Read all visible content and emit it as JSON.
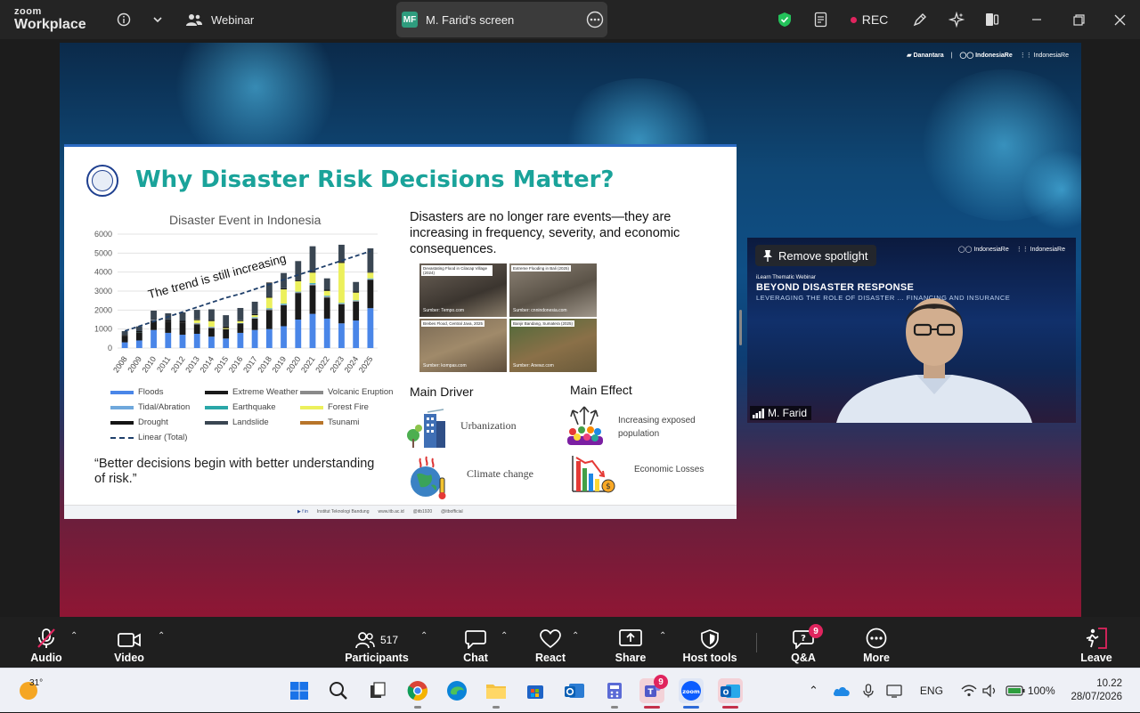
{
  "app": {
    "brand_line1": "zoom",
    "brand_line2": "Workplace",
    "meeting_type": "Webinar",
    "share_initials": "MF",
    "share_label": "M. Farid's screen",
    "rec_label": "REC"
  },
  "slide": {
    "title": "Why Disaster Risk Decisions Matter?",
    "intro": "Disasters are no longer rare events—they are increasing in frequency, severity, and economic consequences.",
    "quote": "“Better decisions begin with better understanding of risk.”",
    "photos": [
      {
        "caption": "Devastating Flood in Cilacap Village (2024)",
        "source": "Sumber: Tempo.com"
      },
      {
        "caption": "Extreme Flooding in Bali (2025)",
        "source": "Sumber: cnnindonesia.com"
      },
      {
        "caption": "Brebes Flood, Central Java, 2025",
        "source": "Sumber: kompas.com"
      },
      {
        "caption": "Banjir Bandang, Sumatera (2025)",
        "source": "Sumber: Anewz.com"
      }
    ],
    "main_driver": {
      "heading": "Main Driver",
      "items": [
        "Urbanization",
        "Climate change"
      ]
    },
    "main_effect": {
      "heading": "Main Effect",
      "items": [
        "Increasing exposed population",
        "Economic Losses"
      ]
    },
    "footer": [
      "Institut Teknologi Bandung",
      "www.itb.ac.id",
      "@itb1920",
      "@itbofficial"
    ]
  },
  "chart_data": {
    "type": "bar",
    "stacked": true,
    "title": "Disaster Event in Indonesia",
    "annotation": "The trend is still increasing",
    "categories": [
      "2008",
      "2009",
      "2010",
      "2011",
      "2012",
      "2013",
      "2014",
      "2015",
      "2016",
      "2017",
      "2018",
      "2019",
      "2020",
      "2021",
      "2022",
      "2023",
      "2024",
      "2025"
    ],
    "ylim": [
      0,
      6000
    ],
    "yticks": [
      0,
      1000,
      2000,
      3000,
      4000,
      5000,
      6000
    ],
    "grid": true,
    "legend_position": "bottom",
    "series": [
      {
        "name": "Floods",
        "color": "#4a86e8",
        "values": [
          300,
          400,
          950,
          800,
          700,
          750,
          600,
          500,
          800,
          950,
          1000,
          1150,
          1500,
          1800,
          1550,
          1300,
          1450,
          2100
        ]
      },
      {
        "name": "Extreme Weather",
        "color": "#1a1a1a",
        "values": [
          350,
          400,
          500,
          600,
          650,
          500,
          450,
          500,
          500,
          600,
          1000,
          1100,
          1400,
          1500,
          1100,
          1000,
          1000,
          1500
        ]
      },
      {
        "name": "Volcanic Eruption",
        "color": "#8a8a8a",
        "values": [
          0,
          0,
          20,
          0,
          0,
          50,
          40,
          0,
          0,
          30,
          40,
          20,
          30,
          40,
          50,
          30,
          30,
          20
        ]
      },
      {
        "name": "Tidal/Abration",
        "color": "#6fa8dc",
        "values": [
          0,
          0,
          20,
          0,
          0,
          20,
          30,
          0,
          20,
          30,
          30,
          40,
          20,
          40,
          30,
          20,
          20,
          20
        ]
      },
      {
        "name": "Earthquake",
        "color": "#2aa7a8",
        "values": [
          0,
          10,
          0,
          0,
          0,
          0,
          0,
          0,
          0,
          20,
          30,
          30,
          20,
          40,
          30,
          30,
          20,
          30
        ]
      },
      {
        "name": "Forest Fire",
        "color": "#ecf05c",
        "values": [
          0,
          0,
          0,
          0,
          0,
          150,
          300,
          50,
          100,
          100,
          550,
          750,
          550,
          550,
          250,
          2100,
          400,
          300
        ]
      },
      {
        "name": "Drought",
        "color": "#141414",
        "values": [
          40,
          80,
          30,
          80,
          80,
          40,
          70,
          80,
          40,
          60,
          50,
          60,
          60,
          40,
          60,
          60,
          60,
          30
        ]
      },
      {
        "name": "Landslide",
        "color": "#3a4652",
        "values": [
          200,
          250,
          450,
          350,
          450,
          500,
          550,
          600,
          650,
          650,
          750,
          800,
          1000,
          1350,
          600,
          900,
          500,
          1250
        ]
      },
      {
        "name": "Tsunami",
        "color": "#b8752a",
        "values": [
          0,
          0,
          0,
          0,
          0,
          0,
          0,
          0,
          0,
          0,
          10,
          0,
          0,
          0,
          0,
          0,
          0,
          0
        ]
      },
      {
        "name": "Linear (Total)",
        "color": "#1f3f6a",
        "type": "trendline",
        "values": [
          900,
          1150,
          1400,
          1650,
          1900,
          2150,
          2400,
          2650,
          2850,
          3100,
          3350,
          3600,
          3850,
          4100,
          4350,
          4600,
          4850,
          5100
        ]
      }
    ]
  },
  "video": {
    "remove_spotlight": "Remove spotlight",
    "webinar_small": "iLearn Thematic Webinar",
    "webinar_title": "BEYOND DISASTER RESPONSE",
    "webinar_sub": "LEVERAGING THE ROLE OF DISASTER ... FINANCING AND INSURANCE",
    "participant": "M. Farid"
  },
  "toolbar": {
    "audio": "Audio",
    "video": "Video",
    "participants": "Participants",
    "participants_count": "517",
    "chat": "Chat",
    "react": "React",
    "share": "Share",
    "host_tools": "Host tools",
    "qa": "Q&A",
    "qa_badge": "9",
    "more": "More",
    "leave": "Leave"
  },
  "taskbar": {
    "weather": "31°",
    "teams_badge": "9",
    "lang": "ENG",
    "battery": "100%",
    "time": "10.22",
    "date": "28/07/2026"
  }
}
